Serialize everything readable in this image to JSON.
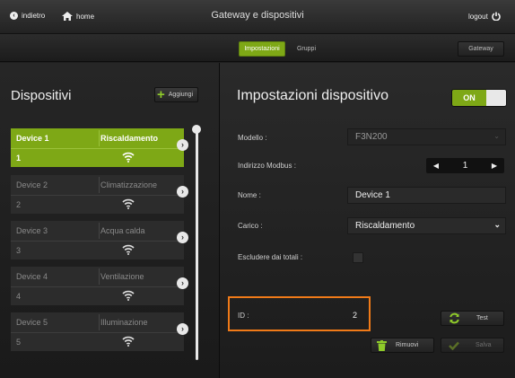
{
  "topbar": {
    "back_label": "indietro",
    "home_label": "home",
    "title": "Gateway e dispositivi",
    "logout_label": "logout"
  },
  "tabs": {
    "settings": "Impostazioni",
    "groups": "Gruppi",
    "gateway": "Gateway"
  },
  "left": {
    "title": "Dispositivi",
    "add_label": "Aggiungi",
    "devices": [
      {
        "name": "Device 1",
        "category": "Riscaldamento",
        "number": "1",
        "selected": true
      },
      {
        "name": "Device 2",
        "category": "Climatizzazione",
        "number": "2",
        "selected": false
      },
      {
        "name": "Device 3",
        "category": "Acqua calda",
        "number": "3",
        "selected": false
      },
      {
        "name": "Device 4",
        "category": "Ventilazione",
        "number": "4",
        "selected": false
      },
      {
        "name": "Device 5",
        "category": "Illuminazione",
        "number": "5",
        "selected": false
      }
    ]
  },
  "right": {
    "title": "Impostazioni dispositivo",
    "toggle_label": "ON",
    "model_label": "Modello :",
    "model_value": "F3N200",
    "modbus_label": "Indirizzo Modbus :",
    "modbus_value": "1",
    "name_label": "Nome :",
    "name_value": "Device 1",
    "load_label": "Carico :",
    "load_value": "Riscaldamento",
    "exclude_label": "Escludere dai totali :",
    "exclude_checked": false,
    "id_label": "ID :",
    "id_value": "2",
    "test_label": "Test",
    "remove_label": "Rimuovi",
    "save_label": "Salva"
  },
  "colors": {
    "accent": "#7ea816",
    "highlight": "#f07a18",
    "background": "#1e1e1e"
  }
}
